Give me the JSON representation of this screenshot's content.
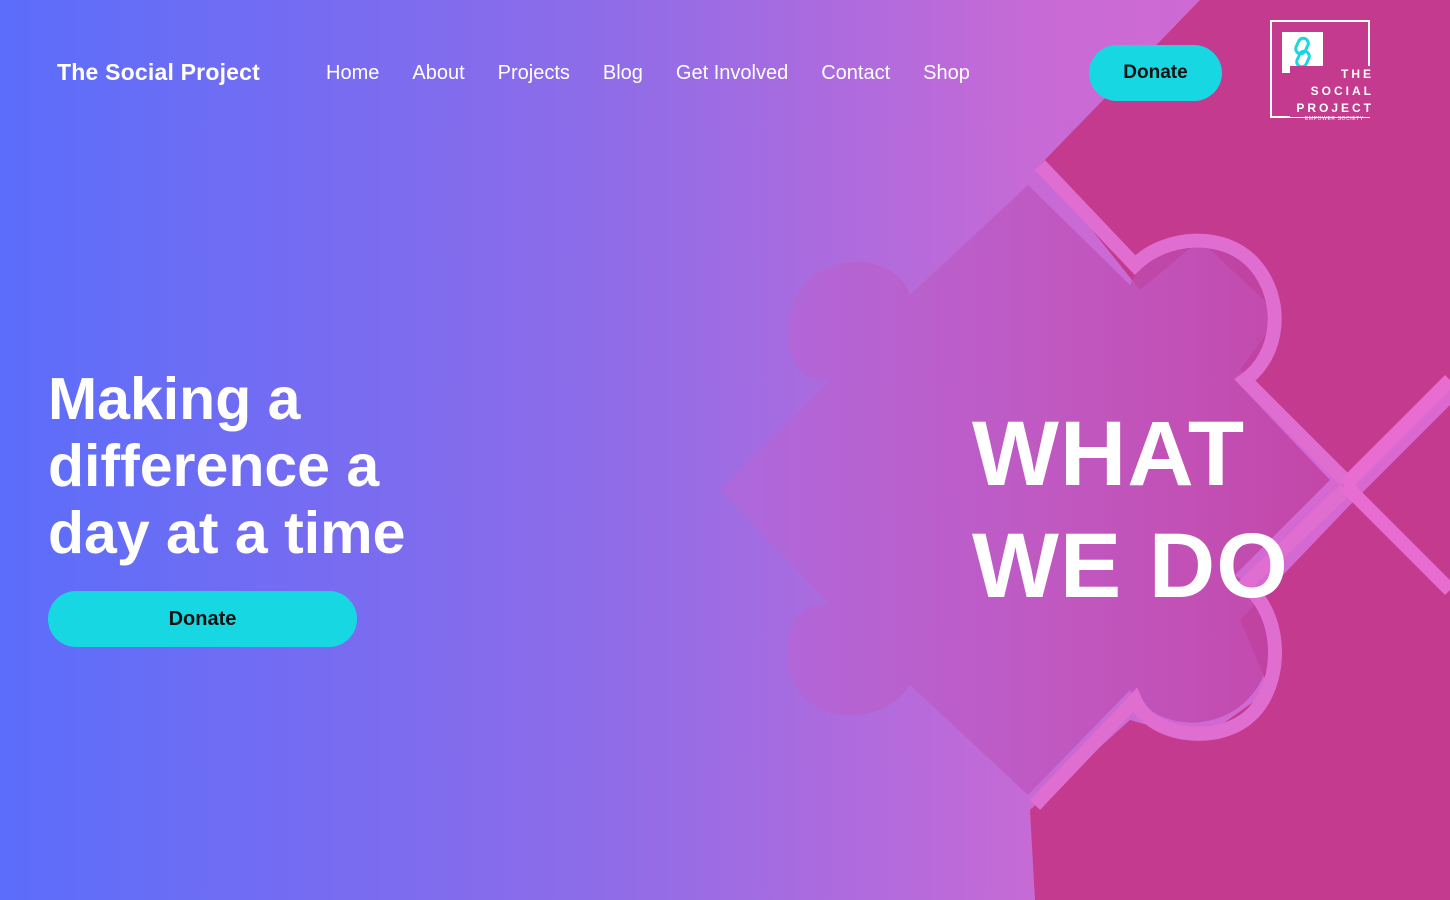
{
  "header": {
    "site_title": "The Social Project",
    "nav_items": [
      "Home",
      "About",
      "Projects",
      "Blog",
      "Get Involved",
      "Contact",
      "Shop"
    ],
    "donate_label": "Donate"
  },
  "logo": {
    "lines": [
      "THE",
      "SOCIAL",
      "PROJECT"
    ],
    "tagline": "EMPOWER SOCIETY",
    "icon": "chain-link-icon"
  },
  "hero": {
    "heading": "Making a difference a day at a time",
    "donate_label": "Donate"
  },
  "section": {
    "title_line1": "WHAT",
    "title_line2": "WE DO"
  },
  "colors": {
    "gradient_start": "#5b6dfb",
    "gradient_end": "#dc68d0",
    "accent_cyan": "#17d8e2",
    "puzzle_magenta": "#c33a8e",
    "puzzle_outline": "#e06ed0"
  }
}
